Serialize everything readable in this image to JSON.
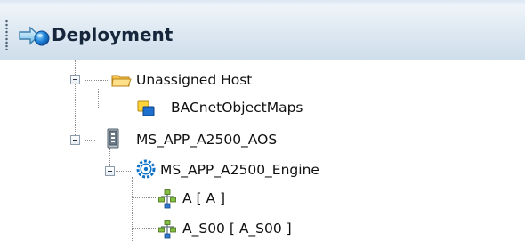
{
  "panel": {
    "title": "Deployment",
    "title_icon": "deployment-arrow-icon"
  },
  "tree": {
    "unassigned_host": {
      "label": "Unassigned Host",
      "icon": "folder-open-icon",
      "expanded": true,
      "children": {
        "bacnet_object_maps": {
          "label": "BACnetObjectMaps",
          "icon": "object-map-icon"
        }
      }
    },
    "app_host": {
      "label": "MS_APP_A2500_AOS",
      "icon": "server-icon",
      "expanded": true,
      "children": {
        "engine": {
          "label": "MS_APP_A2500_Engine",
          "icon": "engine-gear-icon",
          "expanded": true,
          "children": {
            "area_a": {
              "label": "A [ A ]",
              "icon": "area-icon"
            },
            "area_a_s00": {
              "label": "A_S00 [ A_S00 ]",
              "icon": "area-icon"
            }
          }
        }
      }
    }
  }
}
